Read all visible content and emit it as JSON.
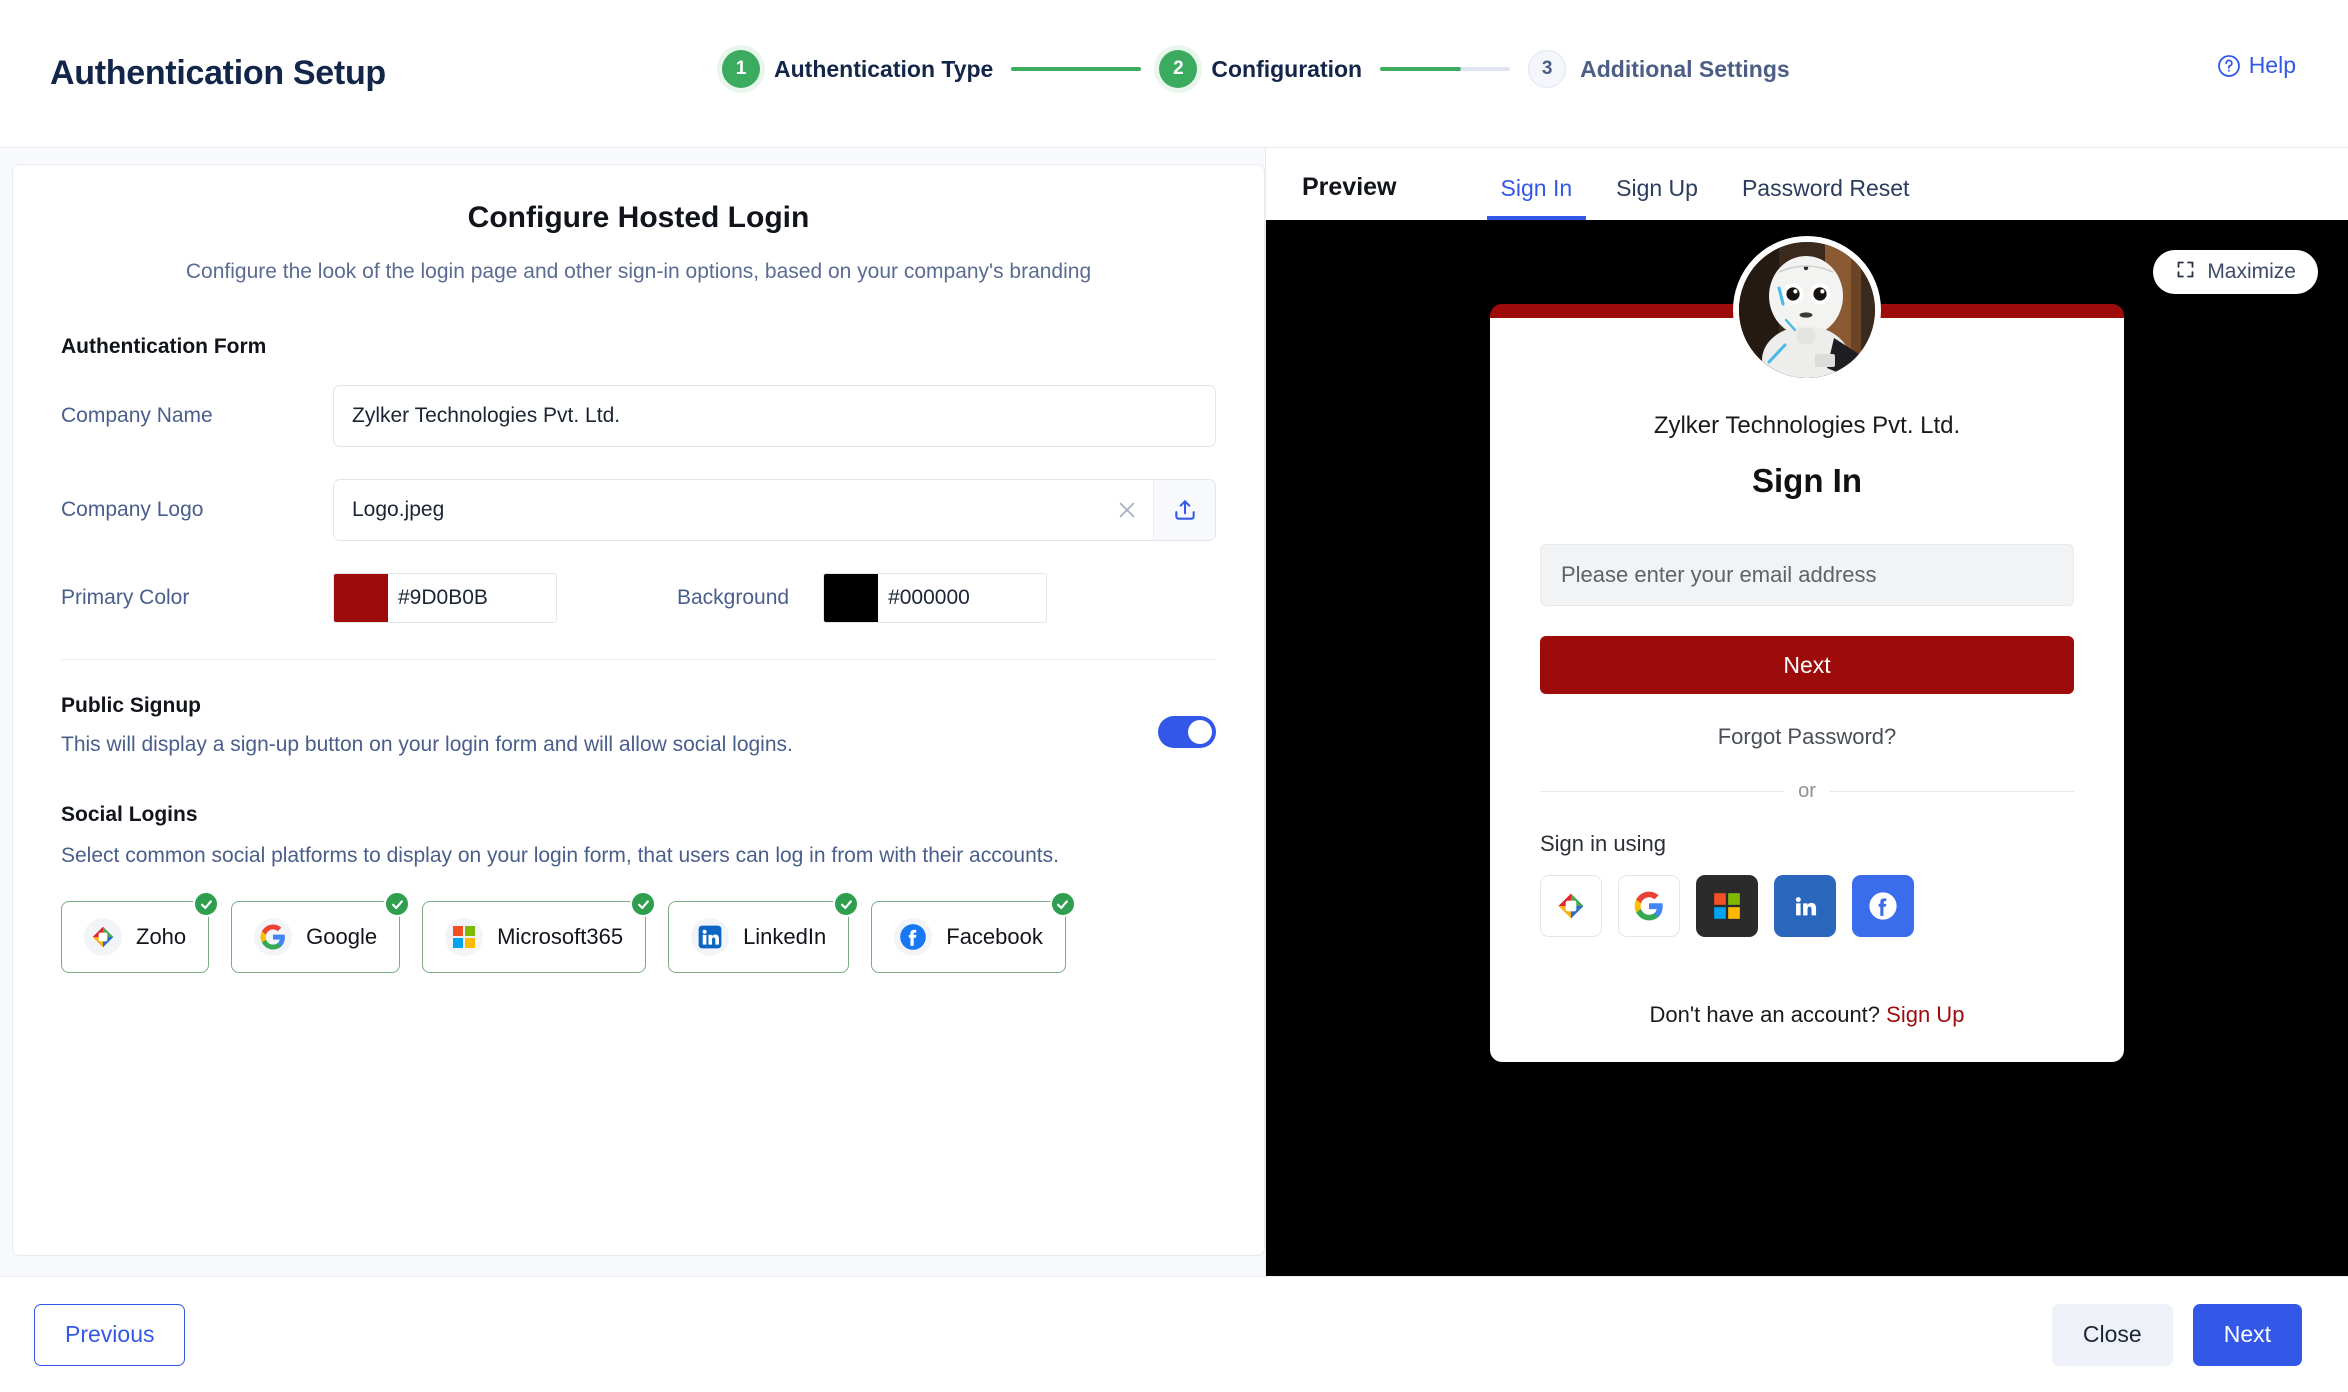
{
  "header": {
    "title": "Authentication Setup",
    "help_label": "Help",
    "help_icon": "question-circle-icon",
    "steps": [
      {
        "num": "1",
        "label": "Authentication Type",
        "state": "done"
      },
      {
        "num": "2",
        "label": "Configuration",
        "state": "done"
      },
      {
        "num": "3",
        "label": "Additional Settings",
        "state": "pending"
      }
    ]
  },
  "left": {
    "card_title": "Configure Hosted Login",
    "card_subtitle": "Configure the look of the login page and other sign-in options, based on your company's branding",
    "section_auth_form": "Authentication Form",
    "company_name_label": "Company Name",
    "company_name_value": "Zylker Technologies Pvt. Ltd.",
    "company_logo_label": "Company Logo",
    "company_logo_value": "Logo.jpeg",
    "clear_icon": "close-icon",
    "upload_icon": "upload-icon",
    "primary_color_label": "Primary Color",
    "primary_color_value": "#9D0B0B",
    "background_label": "Background",
    "background_value": "#000000",
    "public_signup_title": "Public Signup",
    "public_signup_desc": "This will display a sign-up button on your login form and will allow social logins.",
    "public_signup_on": true,
    "social_logins_title": "Social Logins",
    "social_logins_desc": "Select common social platforms to display on your login form, that users can log in from with their accounts.",
    "social_chips": [
      {
        "name": "Zoho",
        "icon": "zoho-icon",
        "selected": true
      },
      {
        "name": "Google",
        "icon": "google-icon",
        "selected": true
      },
      {
        "name": "Microsoft365",
        "icon": "microsoft-icon",
        "selected": true
      },
      {
        "name": "LinkedIn",
        "icon": "linkedin-icon",
        "selected": true
      },
      {
        "name": "Facebook",
        "icon": "facebook-icon",
        "selected": true
      }
    ]
  },
  "preview": {
    "word": "Preview",
    "tabs": [
      {
        "label": "Sign In",
        "active": true
      },
      {
        "label": "Sign Up",
        "active": false
      },
      {
        "label": "Password Reset",
        "active": false
      }
    ],
    "maximize_label": "Maximize",
    "maximize_icon": "maximize-icon",
    "avatar_icon": "robot-avatar",
    "brand_name": "Zylker Technologies Pvt. Ltd.",
    "heading": "Sign In",
    "email_placeholder": "Please enter your email address",
    "next_label": "Next",
    "forgot_label": "Forgot Password?",
    "or_label": "or",
    "signin_using_label": "Sign in using",
    "social_icons": [
      {
        "name": "zoho-icon",
        "style": "plain"
      },
      {
        "name": "google-icon",
        "style": "plain"
      },
      {
        "name": "microsoft-icon",
        "style": "ms"
      },
      {
        "name": "linkedin-icon",
        "style": "li"
      },
      {
        "name": "facebook-icon",
        "style": "fb"
      }
    ],
    "footer_text": "Don't have an account?",
    "footer_link": "Sign Up",
    "accent_color": "#9D0B0B",
    "background_color": "#000000"
  },
  "footer": {
    "previous_label": "Previous",
    "close_label": "Close",
    "next_label": "Next"
  }
}
